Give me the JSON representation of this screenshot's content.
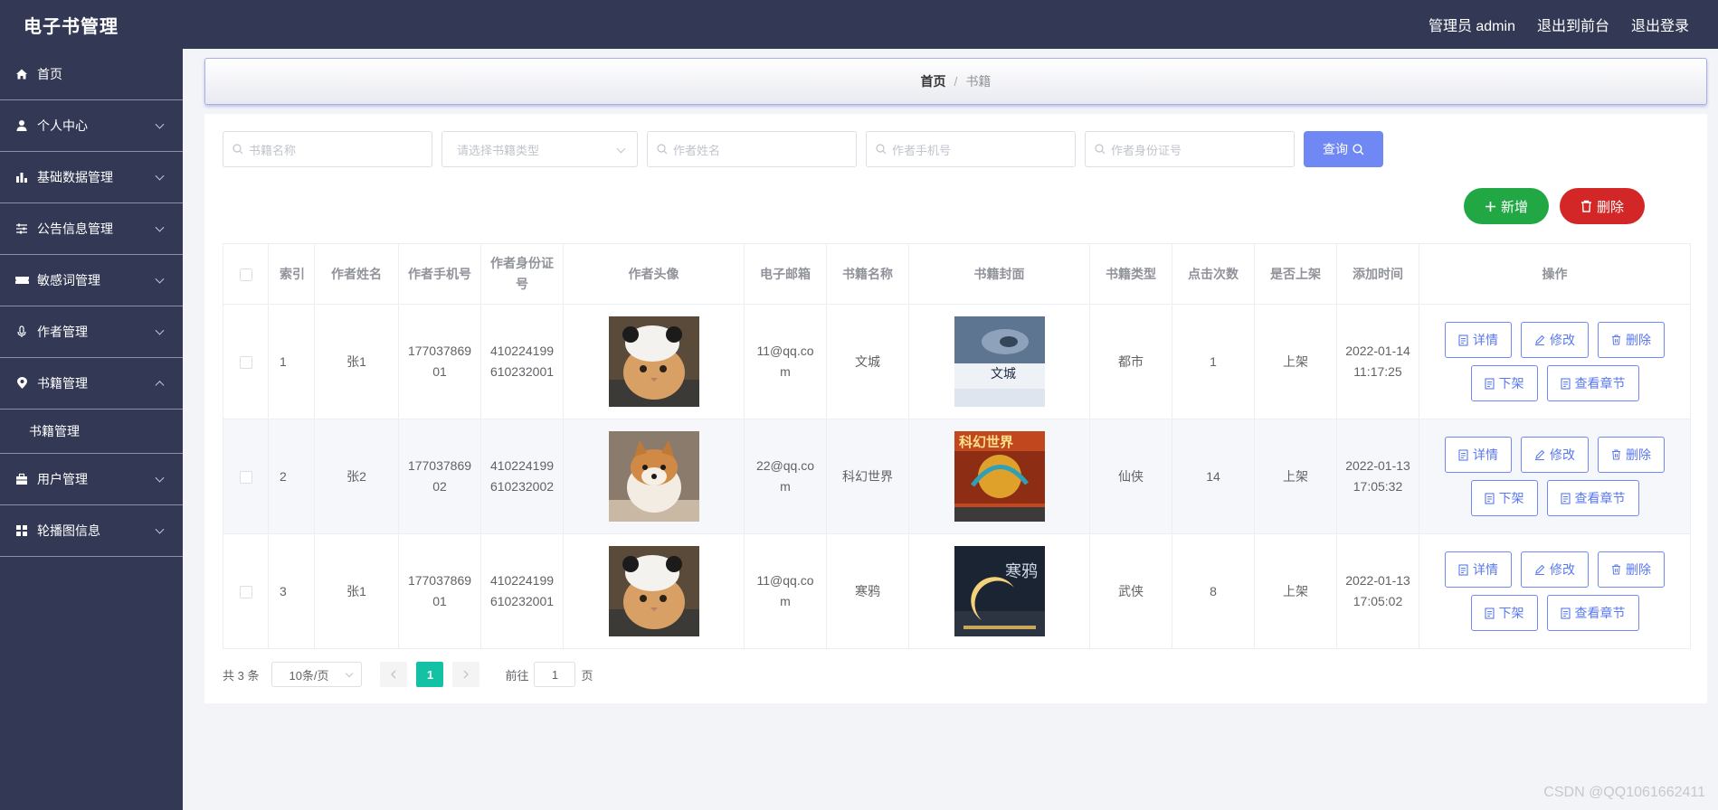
{
  "header": {
    "brand": "电子书管理",
    "admin_label": "管理员 admin",
    "to_front": "退出到前台",
    "logout": "退出登录"
  },
  "sidebar": {
    "items": [
      {
        "label": "首页",
        "icon": "home-icon"
      },
      {
        "label": "个人中心",
        "icon": "user-icon"
      },
      {
        "label": "基础数据管理",
        "icon": "bar-chart-icon"
      },
      {
        "label": "公告信息管理",
        "icon": "sliders-icon"
      },
      {
        "label": "敏感词管理",
        "icon": "ticket-icon"
      },
      {
        "label": "作者管理",
        "icon": "microphone-icon"
      },
      {
        "label": "书籍管理",
        "icon": "location-pin-icon"
      },
      {
        "label": "用户管理",
        "icon": "briefcase-icon"
      },
      {
        "label": "轮播图信息",
        "icon": "grid-icon"
      }
    ],
    "sub_item": "书籍管理"
  },
  "breadcrumb": {
    "home": "首页",
    "sep": "/",
    "current": "书籍"
  },
  "search": {
    "book_name": "书籍名称",
    "book_type": "请选择书籍类型",
    "author_name": "作者姓名",
    "author_phone": "作者手机号",
    "author_id": "作者身份证号",
    "query_label": "查询"
  },
  "actions": {
    "add_label": "新增",
    "delete_label": "删除"
  },
  "table": {
    "headers": [
      "索引",
      "作者姓名",
      "作者手机号",
      "作者身份证号",
      "作者头像",
      "电子邮箱",
      "书籍名称",
      "书籍封面",
      "书籍类型",
      "点击次数",
      "是否上架",
      "添加时间",
      "操作"
    ],
    "op_labels": {
      "detail": "详情",
      "edit": "修改",
      "delete": "删除",
      "off_shelf": "下架",
      "chapters": "查看章节"
    },
    "rows": [
      {
        "index": "1",
        "author": "张1",
        "phone": "17703786901",
        "idcard": "410224199610232001",
        "email": "11@qq.com",
        "book": "文城",
        "type": "都市",
        "clicks": "1",
        "shelf": "上架",
        "time": "2022-01-14 11:17:25",
        "cover_text": "文城"
      },
      {
        "index": "2",
        "author": "张2",
        "phone": "17703786902",
        "idcard": "410224199610232002",
        "email": "22@qq.com",
        "book": "科幻世界",
        "type": "仙侠",
        "clicks": "14",
        "shelf": "上架",
        "time": "2022-01-13 17:05:32",
        "cover_text": "科幻世界"
      },
      {
        "index": "3",
        "author": "张1",
        "phone": "17703786901",
        "idcard": "410224199610232001",
        "email": "11@qq.com",
        "book": "寒鸦",
        "type": "武侠",
        "clicks": "8",
        "shelf": "上架",
        "time": "2022-01-13 17:05:02",
        "cover_text": "寒鸦"
      }
    ]
  },
  "pagination": {
    "total": "共 3 条",
    "page_size": "10条/页",
    "current_page": "1",
    "goto_label": "前往",
    "goto_value": "1",
    "page_suffix": "页"
  },
  "watermark": "CSDN @QQ1061662411",
  "colors": {
    "header_bg": "#333854",
    "primary": "#6f88f3",
    "add": "#21a845",
    "delete": "#d32626",
    "page_active": "#13c2a5"
  }
}
